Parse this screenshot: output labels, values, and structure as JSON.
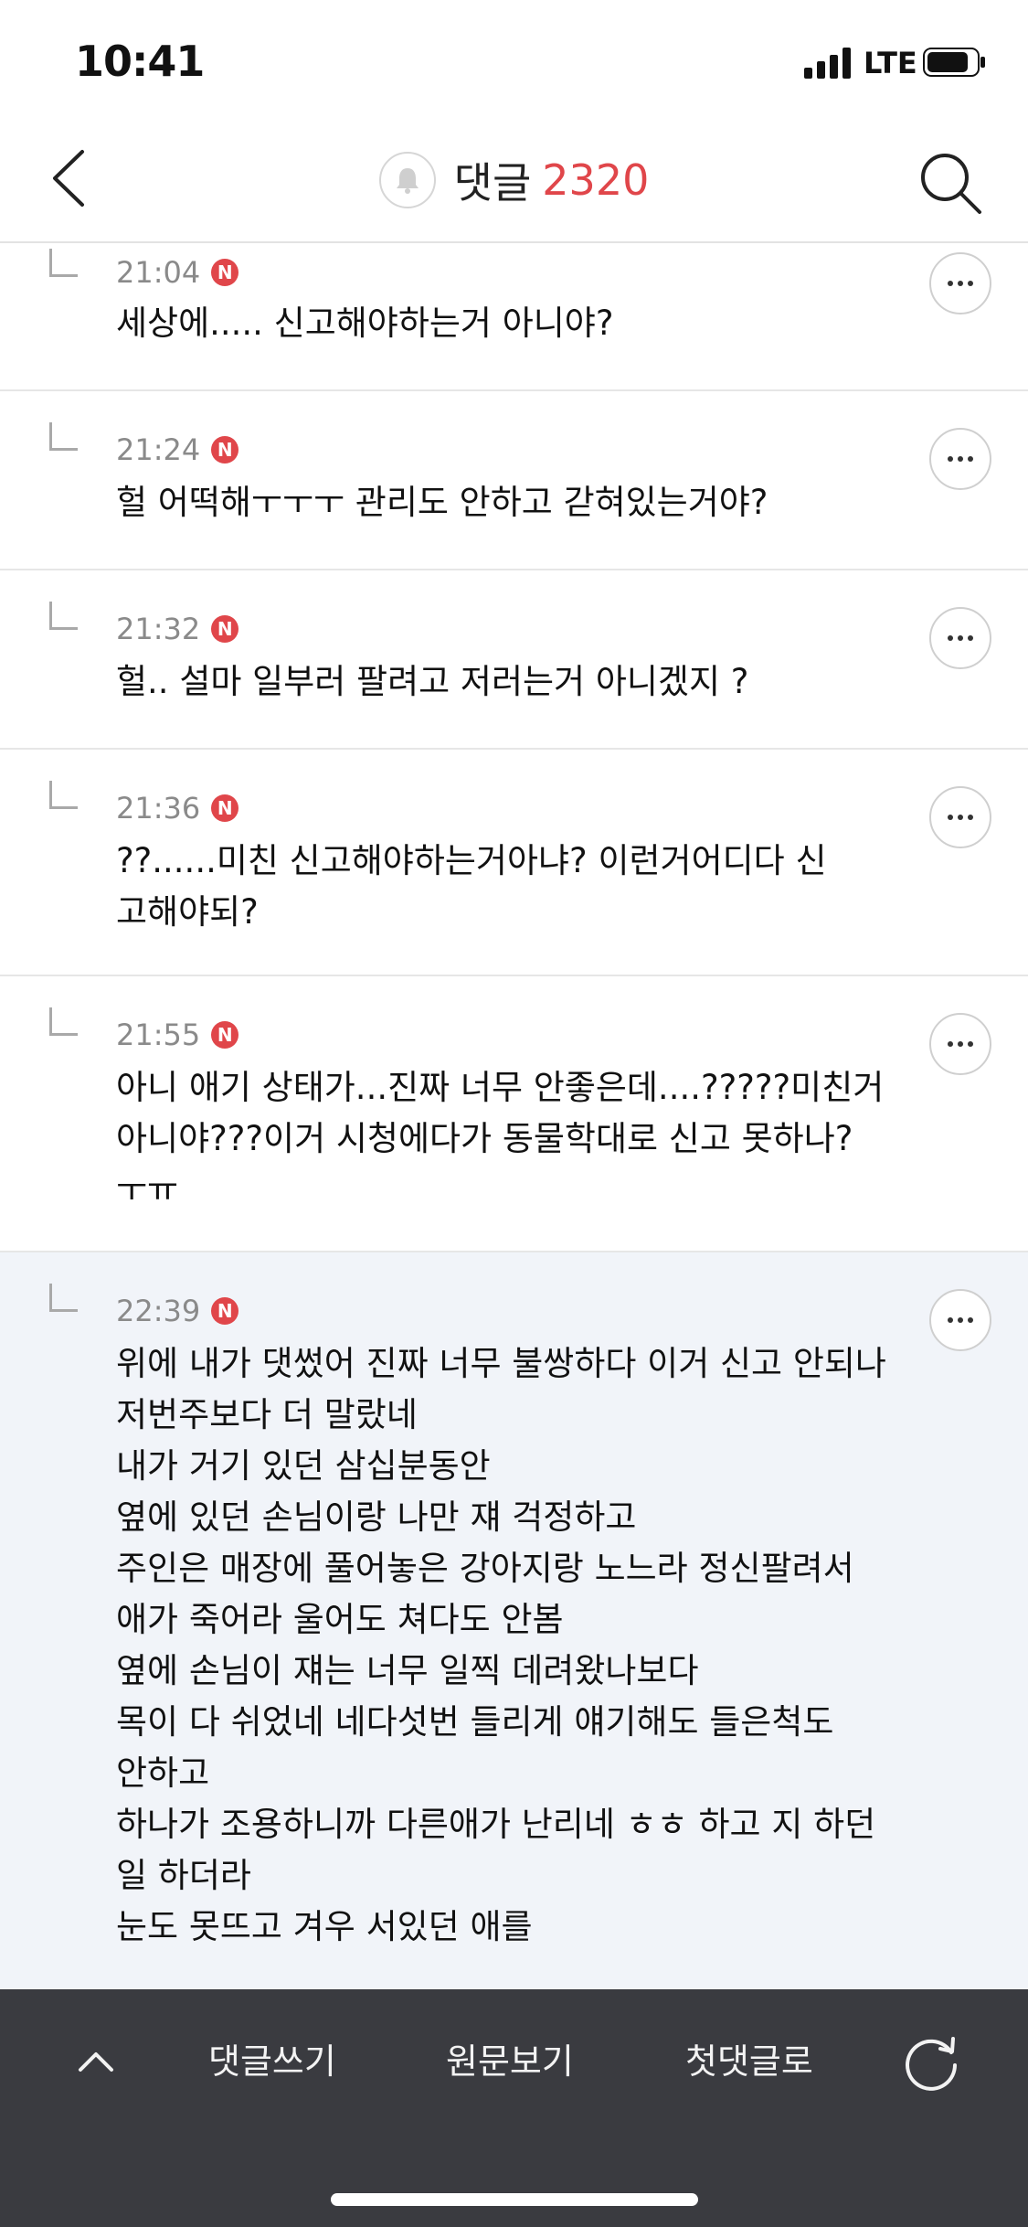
{
  "status_bar": {
    "time": "10:41",
    "network": "LTE"
  },
  "nav": {
    "title": "댓글",
    "count": "2320"
  },
  "badge_label": "N",
  "comments": [
    {
      "time": "21:04",
      "text": "세상에..... 신고해야하는거 아니야?"
    },
    {
      "time": "21:24",
      "text": "헐 어떡해ㅜㅜㅜ 관리도 안하고 갇혀있는거야?"
    },
    {
      "time": "21:32",
      "text": "헐.. 설마 일부러 팔려고 저러는거 아니겠지 ?"
    },
    {
      "time": "21:36",
      "text": "??......미친 신고해야하는거아냐? 이런거어디다 신\n고해야되?"
    },
    {
      "time": "21:55",
      "text": "아니 애기 상태가...진짜 너무 안좋은데....?????미친거\n아니야???이거 시청에다가 동물학대로 신고 못하나?\nㅜㅠ"
    },
    {
      "time": "22:39",
      "text": "위에 내가 댓썼어 진짜 너무 불쌍하다 이거 신고 안되나\n저번주보다 더 말랐네\n내가 거기 있던 삼십분동안\n옆에 있던 손님이랑 나만 쟤 걱정하고\n주인은 매장에 풀어놓은 강아지랑 노느라 정신팔려서\n애가 죽어라 울어도 쳐다도 안봄\n옆에 손님이 쟤는 너무 일찍 데려왔나보다\n목이 다 쉬었네 네다섯번 들리게 얘기해도 들은척도\n안하고\n하나가 조용하니까 다른애가 난리네 ㅎㅎ 하고 지 하던\n일 하더라\n눈도 못뜨고 겨우 서있던 애를"
    }
  ],
  "toolbar": {
    "write": "댓글쓰기",
    "original": "원문보기",
    "first": "첫댓글로"
  },
  "colors": {
    "accent": "#e0464a",
    "toolbar_bg": "#3a3b40",
    "highlight_bg": "#f1f4f9"
  }
}
